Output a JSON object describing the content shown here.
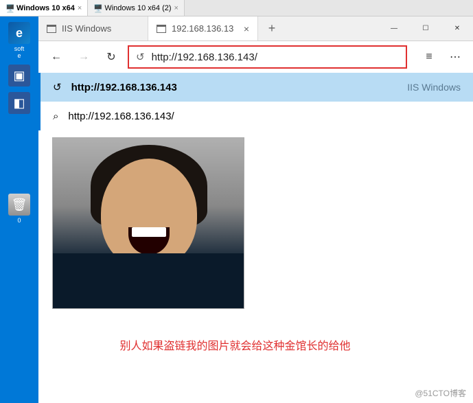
{
  "vm_tabs": [
    {
      "label": "Windows 10 x64",
      "active": true
    },
    {
      "label": "Windows 10 x64 (2)",
      "active": false
    }
  ],
  "desktop": {
    "edge_label": "soft",
    "edge_label2": "e",
    "recycle_label": "0"
  },
  "browser": {
    "tabs": [
      {
        "label": "IIS Windows",
        "active": false
      },
      {
        "label": "192.168.136.13",
        "active": true
      }
    ],
    "nav": {
      "address": "http://192.168.136.143/"
    },
    "suggestions": [
      {
        "text": "http://192.168.136.143",
        "hint": "IIS Windows",
        "selected": true,
        "icon": "history"
      },
      {
        "text": "http://192.168.136.143/",
        "hint": "",
        "selected": false,
        "icon": "search"
      }
    ],
    "caption": "别人如果盗链我的图片就会给这种金馆长的给他"
  },
  "watermark": "@51CTO博客",
  "glyphs": {
    "close_x": "×",
    "plus": "+",
    "back": "←",
    "forward": "→",
    "refresh": "↻",
    "history": "↺",
    "search": "⌕",
    "minimize": "—",
    "maximize": "☐",
    "winclose": "✕",
    "hamburger": "≡",
    "dots": "⋯"
  }
}
